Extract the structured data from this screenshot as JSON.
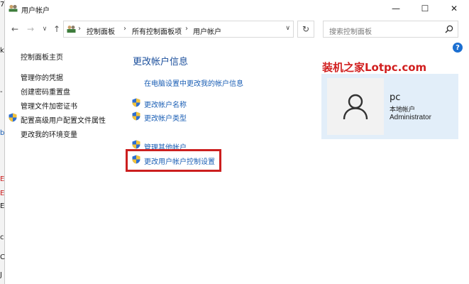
{
  "window": {
    "title": "用户帐户",
    "minimize_glyph": "—",
    "maximize_glyph": "☐",
    "close_glyph": "✕"
  },
  "address_bar": {
    "breadcrumbs": [
      "控制面板",
      "所有控制面板项",
      "用户帐户"
    ],
    "separator": "›",
    "dropdown_glyph": "∨",
    "refresh_glyph": "↻"
  },
  "search": {
    "placeholder": "搜索控制面板"
  },
  "help_glyph": "?",
  "left_nav": {
    "items": [
      "控制面板主页",
      "管理你的凭据",
      "创建密码重置盘",
      "管理文件加密证书",
      "配置高级用户配置文件属性",
      "更改我的环境变量"
    ]
  },
  "main": {
    "title": "更改帐户信息",
    "link_pc_settings": "在电脑设置中更改我的帐户信息",
    "link_change_name": "更改帐户名称",
    "link_change_type": "更改帐户类型",
    "link_manage_other": "管理其他帐户",
    "link_uac_settings": "更改用户帐户控制设置"
  },
  "watermark": "装机之家Lotpc.com",
  "user": {
    "name": "pc",
    "account_type": "本地帐户",
    "role": "Administrator"
  },
  "background_window_fragments": [
    "7",
    "k",
    "-",
    "b",
    "E",
    "E",
    "E",
    "c",
    "C",
    "J"
  ],
  "colors": {
    "link": "#1b5fb5",
    "title_blue": "#1b4f9c",
    "highlight_red": "#cc1f1f",
    "watermark_red": "#d11f1f",
    "user_card_bg": "#e2eef9"
  }
}
